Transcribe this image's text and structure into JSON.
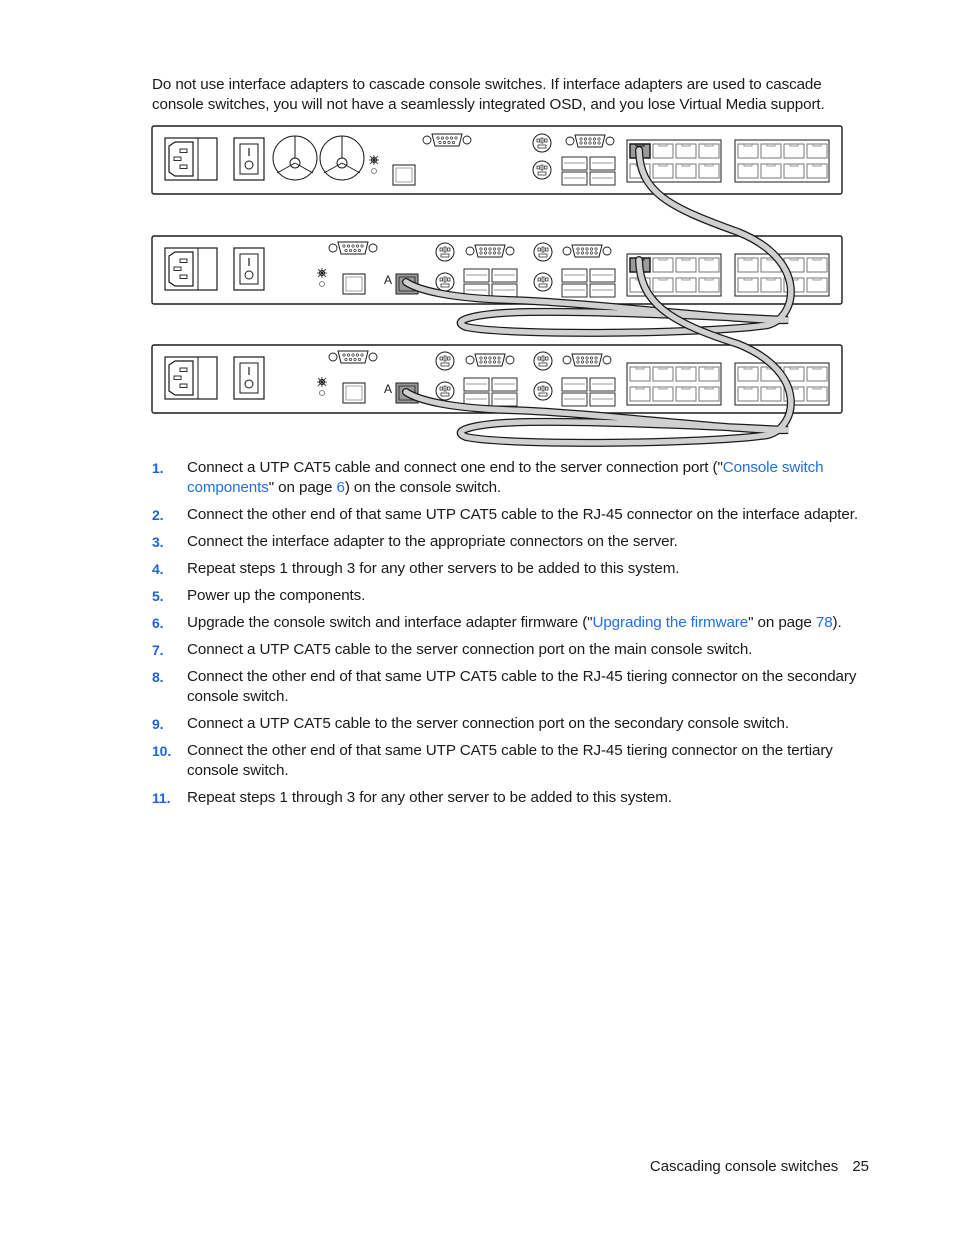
{
  "intro": {
    "text": "Do not use interface adapters to cascade console switches. If interface adapters are used to cascade console switches, you will not have a seamlessly integrated OSD, and you lose Virtual Media support."
  },
  "figure": {
    "description": "Three cascaded console switches (rear panels) connected by UTP CAT5 cables",
    "units": [
      {
        "role": "main",
        "tier_port_label": ""
      },
      {
        "role": "secondary",
        "tier_port_label": "A"
      },
      {
        "role": "tertiary",
        "tier_port_label": "A"
      }
    ],
    "colors": {
      "cable": "#d0d0d0",
      "outline": "#1a1a1a",
      "port_fill": "#9a9a9a"
    }
  },
  "steps": [
    {
      "num": "1.",
      "before": "Connect a UTP CAT5 cable and connect one end to the server connection port (\"",
      "link1": "Console switch components",
      "middle": "\" on page ",
      "link2": "6",
      "after": ") on the console switch."
    },
    {
      "num": "2.",
      "text": "Connect the other end of that same UTP CAT5 cable to the RJ-45 connector on the interface adapter."
    },
    {
      "num": "3.",
      "text": "Connect the interface adapter to the appropriate connectors on the server."
    },
    {
      "num": "4.",
      "text": "Repeat steps 1 through 3 for any other servers to be added to this system."
    },
    {
      "num": "5.",
      "text": "Power up the components."
    },
    {
      "num": "6.",
      "before": "Upgrade the console switch and interface adapter firmware (\"",
      "link1": "Upgrading the firmware",
      "middle": "\" on page ",
      "link2": "78",
      "after": ")."
    },
    {
      "num": "7.",
      "text": "Connect a UTP CAT5 cable to the server connection port on the main console switch."
    },
    {
      "num": "8.",
      "text": "Connect the other end of that same UTP CAT5 cable to the RJ-45 tiering connector on the secondary console switch."
    },
    {
      "num": "9.",
      "text": "Connect a UTP CAT5 cable to the server connection port on the secondary console switch."
    },
    {
      "num": "10.",
      "text": "Connect the other end of that same UTP CAT5 cable to the RJ-45 tiering connector on the tertiary console switch."
    },
    {
      "num": "11.",
      "text": "Repeat steps 1 through 3 for any other server to be added to this system."
    }
  ],
  "footer": {
    "section": "Cascading console switches",
    "page": "25"
  },
  "colors": {
    "link": "#1f6fe5",
    "step_number": "#1e63d6"
  }
}
